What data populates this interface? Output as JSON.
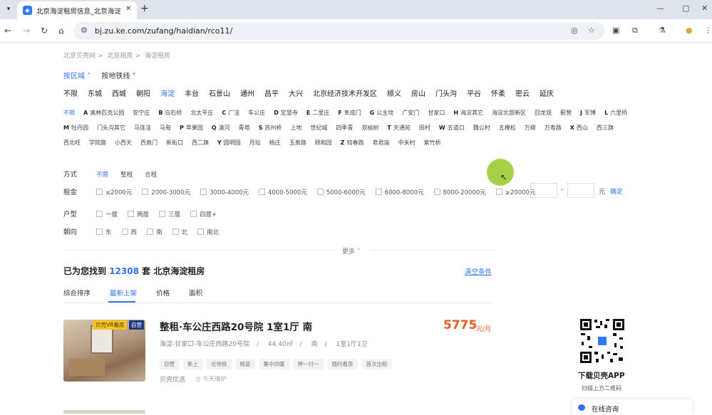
{
  "browser": {
    "tab_title": "北京海淀租房信息_北京海淀出租",
    "url": "bj.zu.ke.com/zufang/haidian/rco11/"
  },
  "breadcrumb": [
    "北京贝壳网",
    "北京租房",
    "海淀租房"
  ],
  "modes": {
    "active": "按区域",
    "other": "按地铁线"
  },
  "districts": [
    "不限",
    "东城",
    "西城",
    "朝阳",
    "海淀",
    "丰台",
    "石景山",
    "通州",
    "昌平",
    "大兴",
    "北京经济技术开发区",
    "顺义",
    "房山",
    "门头沟",
    "平谷",
    "怀柔",
    "密云",
    "延庆"
  ],
  "sub_areas": [
    {
      "text": "不限",
      "active": true
    },
    {
      "letter": "A",
      "text": "奥林匹克公园"
    },
    {
      "text": "安宁庄"
    },
    {
      "letter": "B",
      "text": "白石桥"
    },
    {
      "text": "北太平庄"
    },
    {
      "letter": "C",
      "text": "厂洼"
    },
    {
      "text": "车公庄"
    },
    {
      "letter": "D",
      "text": "定慧寺"
    },
    {
      "letter": "E",
      "text": "二里庄"
    },
    {
      "letter": "F",
      "text": "阜成门"
    },
    {
      "letter": "G",
      "text": "公主坟"
    },
    {
      "text": "广安门"
    },
    {
      "text": "甘家口"
    },
    {
      "letter": "H",
      "text": "海淀其它"
    },
    {
      "text": "海淀北部新区"
    },
    {
      "text": "回龙观"
    },
    {
      "text": "蓟营"
    },
    {
      "letter": "J",
      "text": "军博"
    },
    {
      "letter": "L",
      "text": "六里桥"
    },
    {
      "letter": "M",
      "text": "牡丹园"
    },
    {
      "text": "门头沟其它"
    },
    {
      "text": "马连洼"
    },
    {
      "text": "马甸"
    },
    {
      "letter": "P",
      "text": "苹果园"
    },
    {
      "letter": "Q",
      "text": "清河"
    },
    {
      "text": "青塔"
    },
    {
      "letter": "S",
      "text": "苏州桥"
    },
    {
      "text": "上地"
    },
    {
      "text": "世纪城"
    },
    {
      "text": "四季青"
    },
    {
      "text": "双榆树"
    },
    {
      "letter": "T",
      "text": "天通苑"
    },
    {
      "text": "田村"
    },
    {
      "letter": "W",
      "text": "五道口"
    },
    {
      "text": "魏公村"
    },
    {
      "text": "五棵松"
    },
    {
      "text": "万柳"
    },
    {
      "text": "万寿路"
    },
    {
      "letter": "X",
      "text": "西山"
    },
    {
      "text": "西三旗"
    },
    {
      "text": "西北旺"
    },
    {
      "text": "学院路"
    },
    {
      "text": "小西天"
    },
    {
      "text": "西直门"
    },
    {
      "text": "新街口"
    },
    {
      "text": "西二旗"
    },
    {
      "letter": "Y",
      "text": "圆明园"
    },
    {
      "text": "月坛"
    },
    {
      "text": "杨庄"
    },
    {
      "text": "玉泉路"
    },
    {
      "text": "颐和园"
    },
    {
      "letter": "Z",
      "text": "知春路"
    },
    {
      "text": "皂君庙"
    },
    {
      "text": "中关村"
    },
    {
      "text": "紫竹桥"
    }
  ],
  "filters": {
    "mode": {
      "label": "方式",
      "options": [
        "不限",
        "整租",
        "合租"
      ]
    },
    "rent": {
      "label": "租金",
      "options": [
        "≤2000元",
        "2000-3000元",
        "3000-4000元",
        "4000-5000元",
        "5000-6000元",
        "6000-8000元",
        "8000-20000元",
        "≥20000元"
      ],
      "unit": "元",
      "confirm": "确定",
      "dash": "-"
    },
    "layout": {
      "label": "户型",
      "options": [
        "一居",
        "两居",
        "三居",
        "四居+"
      ]
    },
    "orientation": {
      "label": "朝向",
      "options": [
        "东",
        "西",
        "南",
        "北",
        "南北"
      ]
    }
  },
  "more_label": "更多",
  "result": {
    "prefix": "已为您找到",
    "count": "12308",
    "suffix": "套 北京海淀租房",
    "clear": "清空条件"
  },
  "sorts": [
    {
      "label": "综合排序",
      "active": false
    },
    {
      "label": "最新上架",
      "active": true
    },
    {
      "label": "价格",
      "active": false
    },
    {
      "label": "面积",
      "active": false
    }
  ],
  "listing": {
    "badge_vr": "贝壳VR看房",
    "badge_self": "自营",
    "title": "整租·车公庄西路20号院 1室1厅 南",
    "price": "5775",
    "price_unit": "元/月",
    "location": "海淀-甘家口-车公庄西路20号院",
    "area": "44.40㎡",
    "orientation": "南",
    "layout": "1室1厅1卫",
    "tags": [
      "自营",
      "新上",
      "近地铁",
      "精装",
      "集中供暖",
      "押一付一",
      "随时看房",
      "首次出租"
    ],
    "brand": "贝壳优选",
    "time": "今天维护"
  },
  "sidebar": {
    "qr_title": "下载贝壳APP",
    "qr_sub": "扫描上方二维码",
    "consult": "在线咨询"
  },
  "colors": {
    "accent": "#3072f6",
    "price": "#f05a28",
    "badge_vr": "#f3c223"
  }
}
